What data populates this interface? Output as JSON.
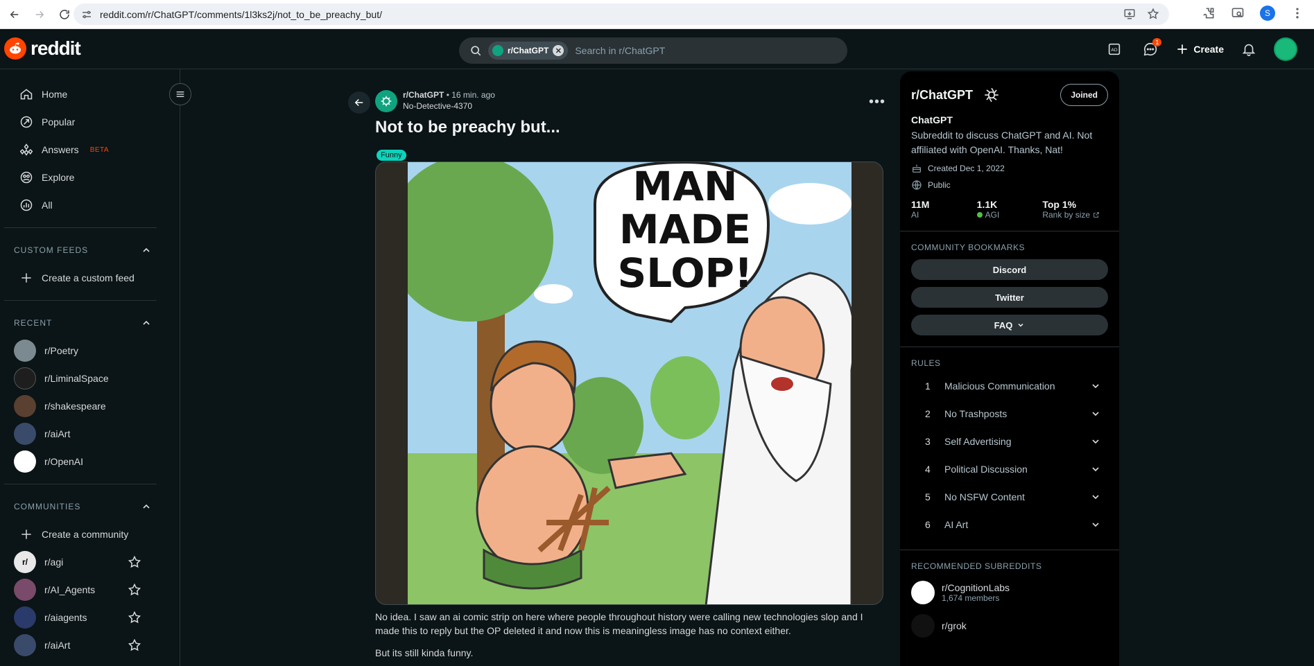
{
  "browser": {
    "url": "reddit.com/r/ChatGPT/comments/1l3ks2j/not_to_be_preachy_but/",
    "profile_initial": "S"
  },
  "header": {
    "logo_text": "reddit",
    "search_chip": "r/ChatGPT",
    "search_placeholder": "Search in r/ChatGPT",
    "chat_badge": "1",
    "create_label": "Create"
  },
  "left_nav": {
    "items": [
      {
        "label": "Home",
        "icon": "home-icon"
      },
      {
        "label": "Popular",
        "icon": "popular-icon"
      },
      {
        "label": "Answers",
        "icon": "answers-icon",
        "badge": "BETA"
      },
      {
        "label": "Explore",
        "icon": "explore-icon"
      },
      {
        "label": "All",
        "icon": "all-icon"
      }
    ],
    "custom_feeds": {
      "heading": "CUSTOM FEEDS",
      "create_label": "Create a custom feed"
    },
    "recent": {
      "heading": "RECENT",
      "items": [
        "r/Poetry",
        "r/LiminalSpace",
        "r/shakespeare",
        "r/aiArt",
        "r/OpenAI"
      ]
    },
    "communities": {
      "heading": "COMMUNITIES",
      "create_label": "Create a community",
      "items": [
        "r/agi",
        "r/AI_Agents",
        "r/aiagents",
        "r/aiArt"
      ]
    }
  },
  "post": {
    "subreddit": "r/ChatGPT",
    "time": "• 16 min. ago",
    "author": "No-Detective-4370",
    "title": "Not to be preachy but...",
    "flair": "Funny",
    "comic_text": [
      "MAN",
      "MADE",
      "SLOP!"
    ],
    "body": [
      "No idea. I saw an ai comic strip on here where people throughout history were calling new technologies slop and I made this to reply but the OP deleted it and now this is meaningless image has no context either.",
      "But its still kinda funny."
    ]
  },
  "sidebar": {
    "title": "r/ChatGPT",
    "joined_label": "Joined",
    "name": "ChatGPT",
    "description": "Subreddit to discuss ChatGPT and AI. Not affiliated with OpenAI. Thanks, Nat!",
    "created": "Created Dec 1, 2022",
    "visibility": "Public",
    "stats": [
      {
        "value": "11M",
        "label": "AI"
      },
      {
        "value": "1.1K",
        "label": "AGI"
      },
      {
        "value": "Top 1%",
        "label": "Rank by size"
      }
    ],
    "bookmarks_heading": "COMMUNITY BOOKMARKS",
    "bookmarks": [
      "Discord",
      "Twitter",
      "FAQ"
    ],
    "rules_heading": "RULES",
    "rules": [
      {
        "num": "1",
        "text": "Malicious Communication"
      },
      {
        "num": "2",
        "text": "No Trashposts"
      },
      {
        "num": "3",
        "text": "Self Advertising"
      },
      {
        "num": "4",
        "text": "Political Discussion"
      },
      {
        "num": "5",
        "text": "No NSFW Content"
      },
      {
        "num": "6",
        "text": "AI Art"
      }
    ],
    "recommended_heading": "RECOMMENDED SUBREDDITS",
    "recommended": [
      {
        "name": "r/CognitionLabs",
        "members": "1,674 members"
      },
      {
        "name": "r/grok",
        "members": ""
      }
    ]
  }
}
